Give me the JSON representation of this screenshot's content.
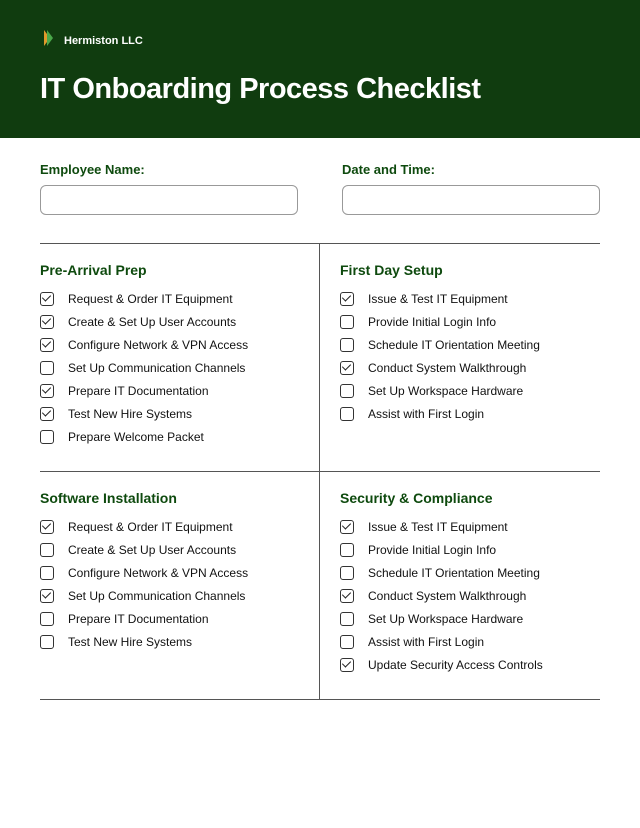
{
  "header": {
    "company": "Hermiston LLC",
    "title": "IT Onboarding Process Checklist"
  },
  "fields": {
    "employee_label": "Employee Name:",
    "employee_value": "",
    "datetime_label": "Date and Time:",
    "datetime_value": ""
  },
  "sections": [
    {
      "title": "Pre-Arrival Prep",
      "side": "left",
      "items": [
        {
          "label": "Request & Order IT Equipment",
          "checked": true
        },
        {
          "label": "Create & Set Up User Accounts",
          "checked": true
        },
        {
          "label": "Configure Network & VPN Access",
          "checked": true
        },
        {
          "label": "Set Up Communication Channels",
          "checked": false
        },
        {
          "label": "Prepare IT Documentation",
          "checked": true
        },
        {
          "label": "Test New Hire Systems",
          "checked": true
        },
        {
          "label": "Prepare Welcome Packet",
          "checked": false
        }
      ]
    },
    {
      "title": "First Day Setup",
      "side": "right",
      "items": [
        {
          "label": "Issue & Test IT Equipment",
          "checked": true
        },
        {
          "label": "Provide Initial Login Info",
          "checked": false
        },
        {
          "label": "Schedule IT Orientation Meeting",
          "checked": false
        },
        {
          "label": "Conduct System Walkthrough",
          "checked": true
        },
        {
          "label": "Set Up Workspace Hardware",
          "checked": false
        },
        {
          "label": "Assist with First Login",
          "checked": false
        }
      ]
    },
    {
      "title": "Software Installation",
      "side": "left",
      "items": [
        {
          "label": "Request & Order IT Equipment",
          "checked": true
        },
        {
          "label": "Create & Set Up User Accounts",
          "checked": false
        },
        {
          "label": "Configure Network & VPN Access",
          "checked": false
        },
        {
          "label": "Set Up Communication Channels",
          "checked": true
        },
        {
          "label": "Prepare IT Documentation",
          "checked": false
        },
        {
          "label": "Test New Hire Systems",
          "checked": false
        }
      ]
    },
    {
      "title": "Security & Compliance",
      "side": "right",
      "items": [
        {
          "label": "Issue & Test IT Equipment",
          "checked": true
        },
        {
          "label": "Provide Initial Login Info",
          "checked": false
        },
        {
          "label": "Schedule IT Orientation Meeting",
          "checked": false
        },
        {
          "label": "Conduct System Walkthrough",
          "checked": true
        },
        {
          "label": "Set Up Workspace Hardware",
          "checked": false
        },
        {
          "label": "Assist with First Login",
          "checked": false
        },
        {
          "label": "Update Security Access Controls",
          "checked": true
        }
      ]
    }
  ]
}
